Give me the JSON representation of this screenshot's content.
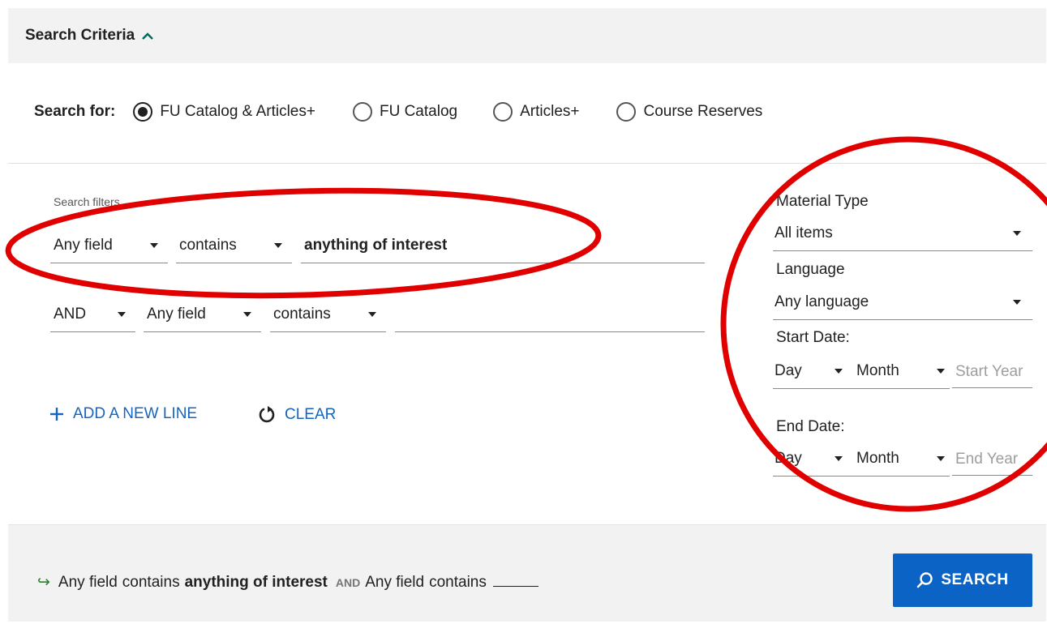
{
  "header": {
    "title": "Search Criteria"
  },
  "search_for": {
    "label": "Search for:",
    "options": [
      {
        "label": "FU Catalog & Articles+",
        "checked": true
      },
      {
        "label": "FU Catalog",
        "checked": false
      },
      {
        "label": "Articles+",
        "checked": false
      },
      {
        "label": "Course Reserves",
        "checked": false
      }
    ]
  },
  "filters": {
    "caption": "Search filters",
    "row1": {
      "field": "Any field",
      "operator": "contains",
      "value": "anything of interest"
    },
    "row2": {
      "boolean": "AND",
      "field": "Any field",
      "operator": "contains",
      "value": ""
    }
  },
  "actions": {
    "add_line": "ADD A NEW LINE",
    "clear": "CLEAR"
  },
  "side": {
    "material_type_label": "Material Type",
    "material_type_value": "All items",
    "language_label": "Language",
    "language_value": "Any language",
    "start_date_label": "Start Date:",
    "start_day": "Day",
    "start_month": "Month",
    "start_year_placeholder": "Start Year",
    "end_date_label": "End Date:",
    "end_day": "Day",
    "end_month": "Month",
    "end_year_placeholder": "End Year"
  },
  "summary": {
    "field1": "Any field",
    "op1": "contains",
    "term1": "anything of interest",
    "boolean": "AND",
    "field2": "Any field",
    "op2": "contains"
  },
  "search_button": {
    "label": "SEARCH"
  },
  "colors": {
    "accent": "#0b63c5",
    "link": "#1565c0",
    "annotation": "#e00000",
    "arrow": "#2e7d32"
  }
}
